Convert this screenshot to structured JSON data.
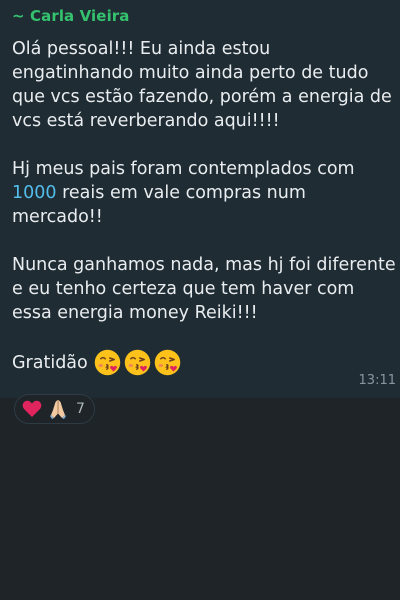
{
  "message": {
    "sender": "~ Carla Vieira",
    "paragraphs": [
      "Olá pessoal!!! Eu ainda estou engatinhando muito ainda perto de tudo que vcs estão fazendo, porém a energia de vcs está reverberando aqui!!!!",
      "Nunca ganhamos nada, mas hj foi diferente e eu tenho certeza que tem haver com essa energia money Reiki!!!"
    ],
    "paragraph2": {
      "before": "Hj meus pais foram contemplados com ",
      "highlight": "1000",
      "after": " reais em vale compras num mercado!!"
    },
    "closing": "Gratidão",
    "emojis": [
      "face-blowing-kiss-icon",
      "face-blowing-kiss-icon",
      "face-blowing-kiss-icon"
    ],
    "timestamp": "13:11",
    "highlight_color": "#53bdeb",
    "sender_color": "#35c26e"
  },
  "reactions": {
    "emojis": [
      "red-heart-icon",
      "folded-hands-icon"
    ],
    "count": "7"
  }
}
